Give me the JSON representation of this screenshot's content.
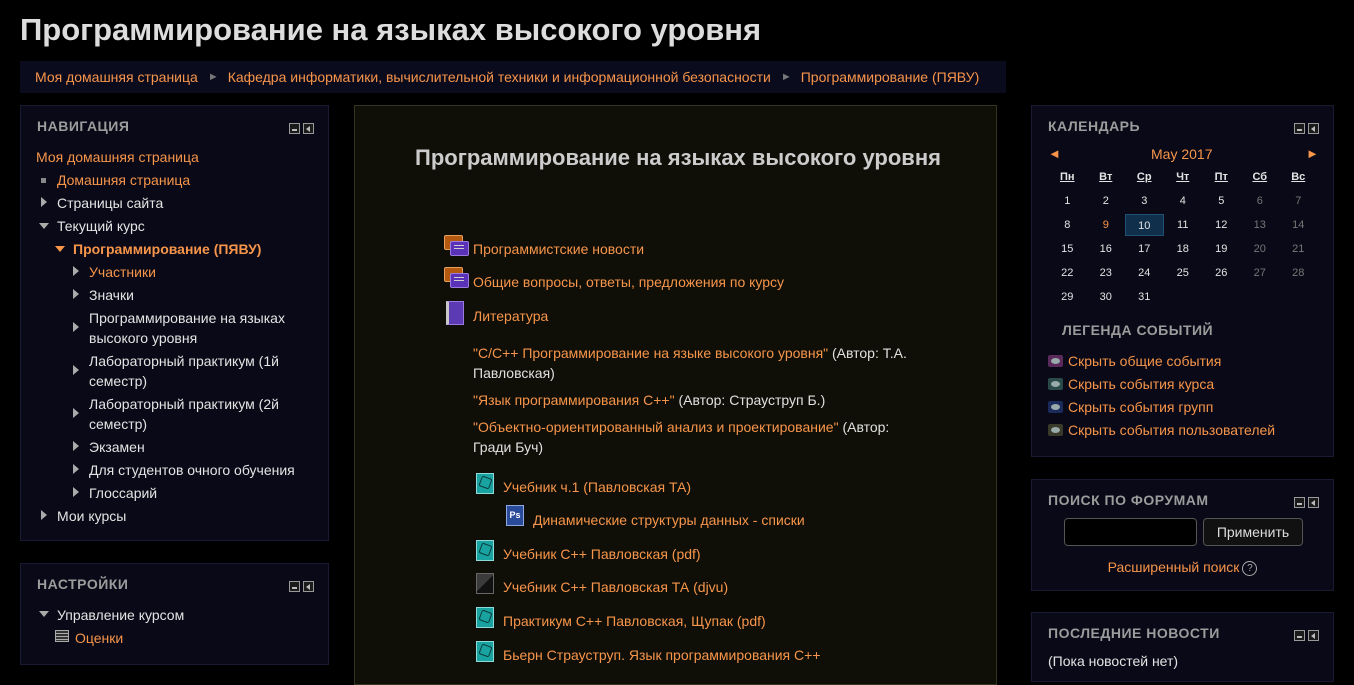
{
  "page": {
    "title": "Программирование на языках высокого уровня"
  },
  "breadcrumb": [
    "Моя домашняя страница",
    "Кафедра информатики, вычислительной техники и информационной безопасности",
    "Программирование (ПЯВУ)"
  ],
  "navigation": {
    "title": "НАВИГАЦИЯ",
    "home": "Моя домашняя страница",
    "site_home": "Домашняя страница",
    "site_pages": "Страницы сайта",
    "current_course": "Текущий курс",
    "course": "Программирование (ПЯВУ)",
    "course_items": [
      "Участники",
      "Значки",
      "Программирование на языках высокого уровня",
      "Лабораторный практикум (1й семестр)",
      "Лабораторный практикум (2й семестр)",
      "Экзамен",
      "Для студентов очного обучения",
      "Глоссарий"
    ],
    "my_courses": "Мои курсы"
  },
  "settings": {
    "title": "НАСТРОЙКИ",
    "course_admin": "Управление курсом",
    "grades": "Оценки"
  },
  "main": {
    "course_title": "Программирование на языках высокого уровня",
    "activities": {
      "news": "Программистские новости",
      "qa": "Общие вопросы, ответы, предложения по курсу",
      "literature": "Литература"
    },
    "literature": [
      {
        "title": "\"C/C++ Программирование на языке высокого уровня\"",
        "author": " (Автор: Т.А. Павловская)"
      },
      {
        "title": "\"Язык программирования С++\"",
        "author": " (Автор: Страуструп Б.)"
      },
      {
        "title": "\"Объектно-ориентированный анализ и проектирование\"",
        "author": " (Автор:  Гради Буч)"
      }
    ],
    "resources": {
      "r1": "Учебник ч.1 (Павловская ТА)",
      "r2": "Динамические структуры данных - списки",
      "r3": "Учебник С++ Павловская (pdf)",
      "r4": "Учебник С++ Павловская ТА (djvu)",
      "r5": "Практикум С++ Павловская, Щупак (pdf)",
      "r6": "Бьерн Страуструп. Язык программирования С++"
    }
  },
  "calendar": {
    "title": "КАЛЕНДАРЬ",
    "prev": "◄",
    "next": "►",
    "month": "May 2017",
    "weekdays": [
      "Пн",
      "Вт",
      "Ср",
      "Чт",
      "Пт",
      "Сб",
      "Вс"
    ],
    "weeks": [
      [
        "1",
        "2",
        "3",
        "4",
        "5",
        "6",
        "7"
      ],
      [
        "8",
        "9",
        "10",
        "11",
        "12",
        "13",
        "14"
      ],
      [
        "15",
        "16",
        "17",
        "18",
        "19",
        "20",
        "21"
      ],
      [
        "22",
        "23",
        "24",
        "25",
        "26",
        "27",
        "28"
      ],
      [
        "29",
        "30",
        "31",
        "",
        "",
        "",
        ""
      ]
    ],
    "today": "10",
    "event_day": "9",
    "legend_title": "ЛЕГЕНДА СОБЫТИЙ",
    "legend": [
      {
        "label": "Скрыть общие события",
        "color": "#5a2a5a"
      },
      {
        "label": "Скрыть события курса",
        "color": "#2a4a4a"
      },
      {
        "label": "Скрыть события групп",
        "color": "#1a2a5a"
      },
      {
        "label": "Скрыть события пользователей",
        "color": "#3a3a2a"
      }
    ]
  },
  "forum_search": {
    "title": "ПОИСК ПО ФОРУМАМ",
    "query": "",
    "button": "Применить",
    "advanced": "Расширенный поиск",
    "help": "?"
  },
  "news": {
    "title": "ПОСЛЕДНИЕ НОВОСТИ",
    "empty": "(Пока новостей нет)"
  }
}
